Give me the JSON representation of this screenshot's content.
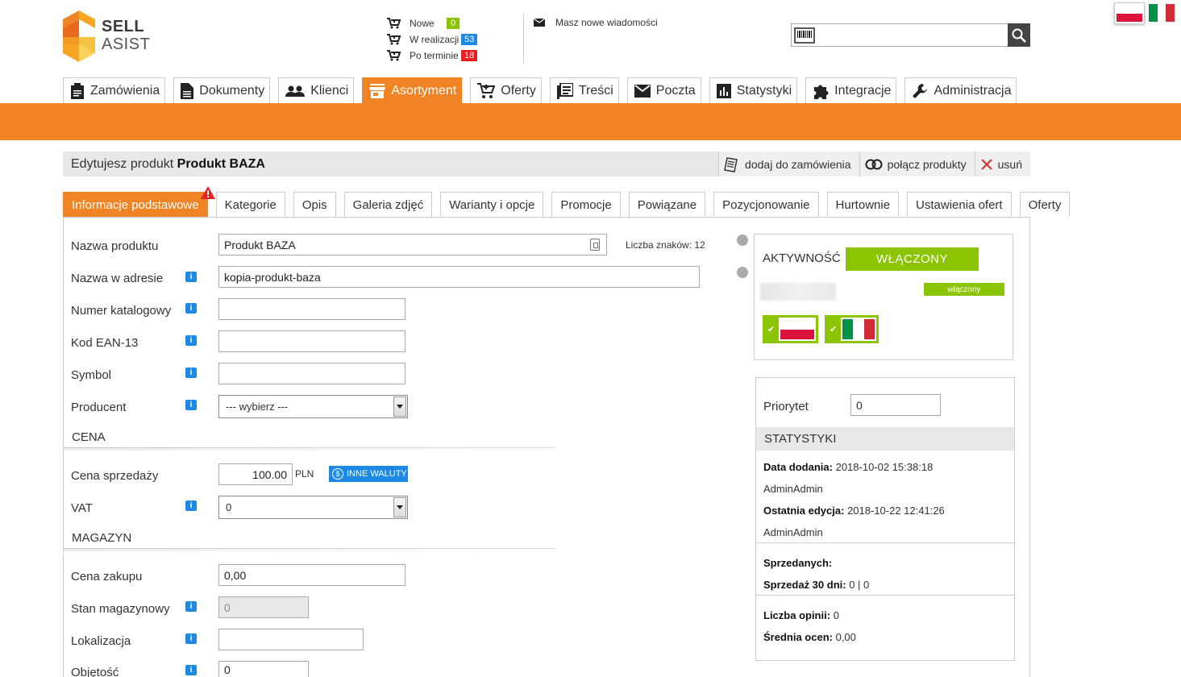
{
  "brand": {
    "line1": "SELL",
    "line2": "ASIST"
  },
  "order_stats": [
    {
      "label": "Nowe",
      "count": "0",
      "color": "#8bc400"
    },
    {
      "label": "W realizacji",
      "count": "53",
      "color": "#1e88e5"
    },
    {
      "label": "Po terminie",
      "count": "18",
      "color": "#e52121"
    }
  ],
  "messages": {
    "text": "Masz nowe wiadomości"
  },
  "search": {
    "placeholder": ""
  },
  "nav": [
    {
      "label": "Zamówienia",
      "icon": "clipboard-icon"
    },
    {
      "label": "Dokumenty",
      "icon": "document-icon"
    },
    {
      "label": "Klienci",
      "icon": "people-icon"
    },
    {
      "label": "Asortyment",
      "icon": "store-icon",
      "active": true
    },
    {
      "label": "Oferty",
      "icon": "cart-icon"
    },
    {
      "label": "Treści",
      "icon": "list-icon"
    },
    {
      "label": "Poczta",
      "icon": "mail-icon"
    },
    {
      "label": "Statystyki",
      "icon": "chart-icon"
    },
    {
      "label": "Integracje",
      "icon": "puzzle-icon"
    },
    {
      "label": "Administracja",
      "icon": "wrench-icon"
    }
  ],
  "page": {
    "title_prefix": "Edytujesz produkt",
    "title_product": "Produkt BAZA",
    "actions": {
      "add_to_order": "dodaj do zamówienia",
      "merge": "połącz produkty",
      "delete": "usuń"
    }
  },
  "tabs": [
    {
      "label": "Informacje podstawowe",
      "active": true
    },
    {
      "label": "Kategorie"
    },
    {
      "label": "Opis"
    },
    {
      "label": "Galeria zdjęć"
    },
    {
      "label": "Warianty i opcje"
    },
    {
      "label": "Promocje"
    },
    {
      "label": "Powiązane"
    },
    {
      "label": "Pozycjonowanie"
    },
    {
      "label": "Hurtownie"
    },
    {
      "label": "Ustawienia ofert"
    },
    {
      "label": "Oferty"
    }
  ],
  "form": {
    "name": {
      "label": "Nazwa produktu",
      "value": "Produkt BAZA",
      "counter": "Liczba znaków: 12"
    },
    "slug": {
      "label": "Nazwa w adresie",
      "value": "kopia-produkt-baza"
    },
    "catalog": {
      "label": "Numer katalogowy",
      "value": ""
    },
    "ean": {
      "label": "Kod EAN-13",
      "value": ""
    },
    "symbol": {
      "label": "Symbol",
      "value": ""
    },
    "producer": {
      "label": "Producent",
      "value": "--- wybierz ---"
    },
    "section_price": "CENA",
    "price": {
      "label": "Cena sprzedaży",
      "value": "100.00",
      "currency": "PLN",
      "other_currencies": "INNE WALUTY"
    },
    "vat": {
      "label": "VAT",
      "value": "0"
    },
    "section_stock": "MAGAZYN",
    "purchase": {
      "label": "Cena zakupu",
      "value": "0,00"
    },
    "stock": {
      "label": "Stan magazynowy",
      "value": "0"
    },
    "location": {
      "label": "Lokalizacja",
      "value": ""
    },
    "volume": {
      "label": "Objętość",
      "value": "0"
    }
  },
  "side": {
    "activity_label": "AKTYWNOŚĆ",
    "activity_state": "WŁĄCZONY",
    "small_state": "włączony",
    "priority_label": "Priorytet",
    "priority_value": "0",
    "stats_title": "STATYSTYKI",
    "added_label": "Data dodania:",
    "added_value": "2018-10-02 15:38:18",
    "added_by": "AdminAdmin",
    "edited_label": "Ostatnia edycja:",
    "edited_value": "2018-10-22 12:41:26",
    "edited_by": "AdminAdmin",
    "sold_label": "Sprzedanych:",
    "sold_value": "",
    "sold30_label": "Sprzedaż 30 dni:",
    "sold30_value": "0 | 0",
    "reviews_label": "Liczba opinii:",
    "reviews_value": "0",
    "rating_label": "Średnia ocen:",
    "rating_value": "0,00"
  },
  "colors": {
    "accent": "#f08424",
    "green": "#8bc400",
    "blue": "#1e88e5",
    "red": "#e52121"
  }
}
